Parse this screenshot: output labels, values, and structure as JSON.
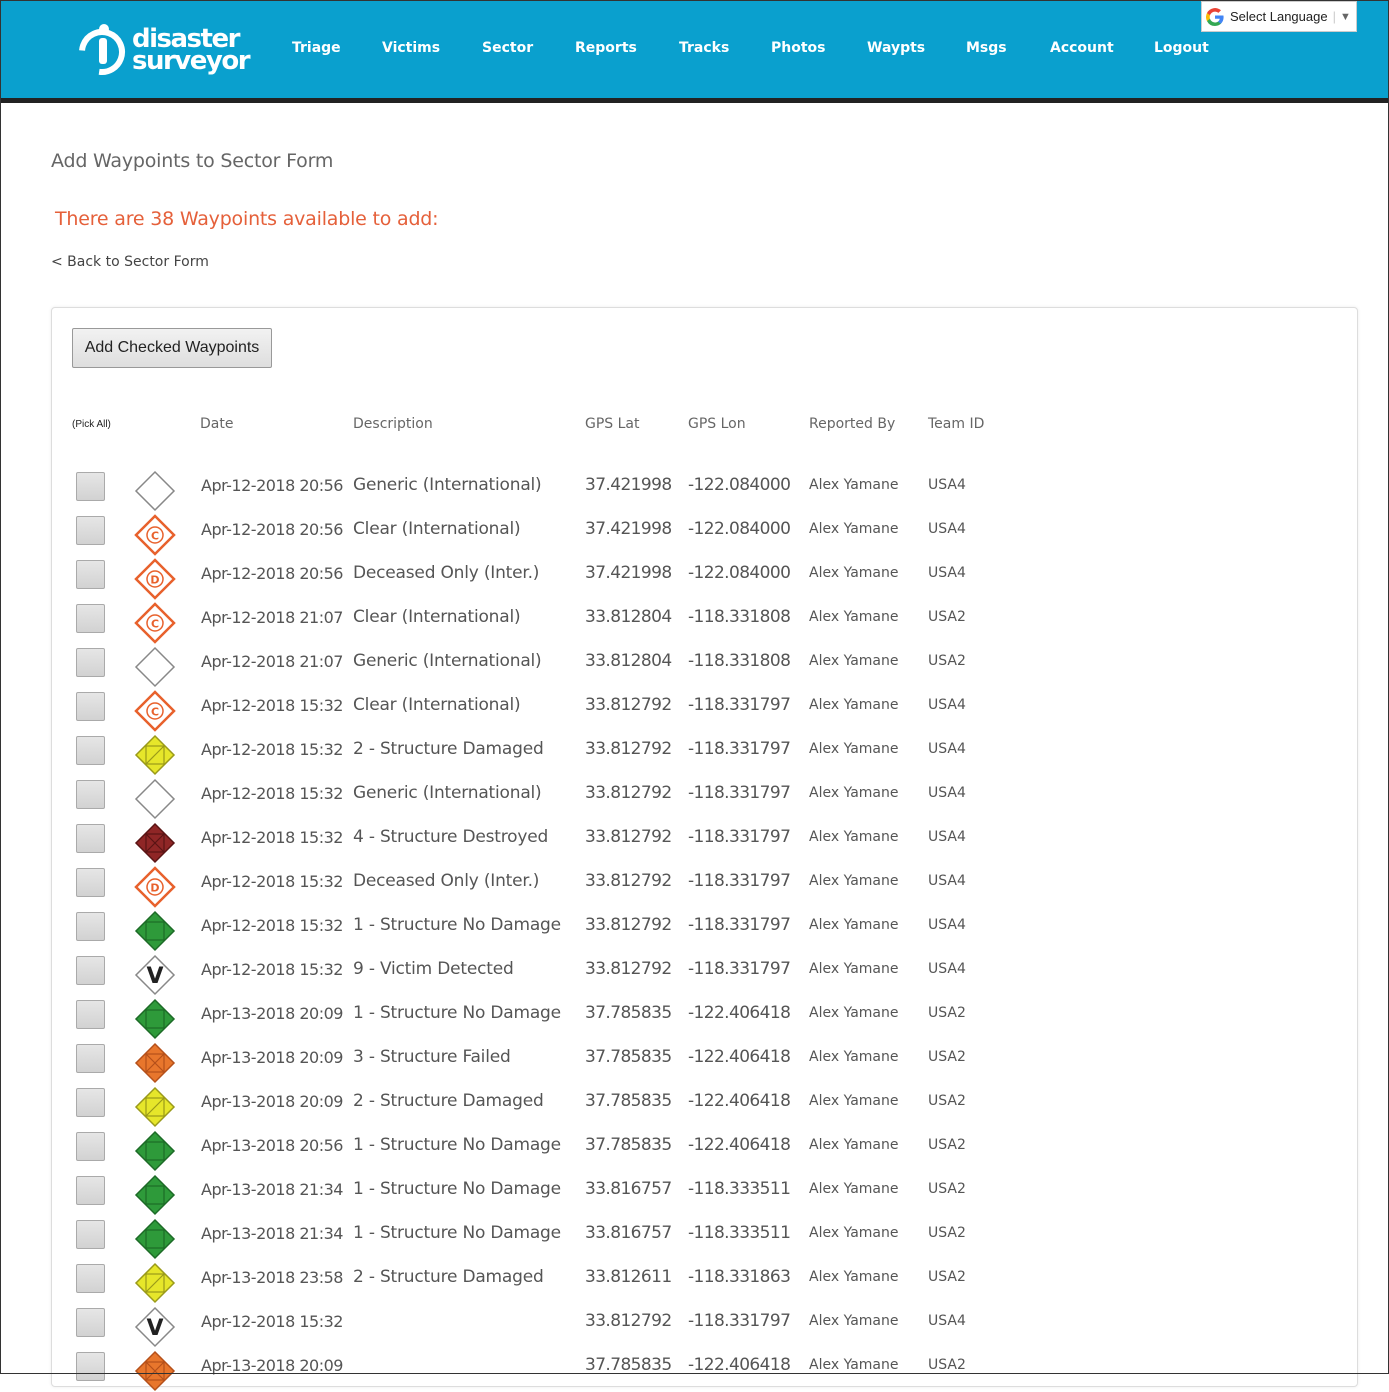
{
  "header": {
    "logo_line1": "disaster",
    "logo_line2": "surveyor",
    "nav": [
      "Triage",
      "Victims",
      "Sector",
      "Reports",
      "Tracks",
      "Photos",
      "Waypts",
      "Msgs",
      "Account",
      "Logout"
    ],
    "language_label": "Select Language"
  },
  "page": {
    "title": "Add Waypoints to Sector Form",
    "available": "There are 38 Waypoints available to add:",
    "back_link": "< Back to Sector Form",
    "add_button": "Add Checked Waypoints"
  },
  "table": {
    "pick_all": "(Pick All)",
    "headers": {
      "date": "Date",
      "description": "Description",
      "lat": "GPS Lat",
      "lon": "GPS Lon",
      "reported_by": "Reported By",
      "team": "Team ID"
    },
    "rows": [
      {
        "icon": "generic",
        "date": "Apr-12-2018 20:56",
        "desc": "Generic (International)",
        "lat": "37.421998",
        "lon": "-122.084000",
        "by": "Alex Yamane",
        "team": "USA4"
      },
      {
        "icon": "clear",
        "date": "Apr-12-2018 20:56",
        "desc": "Clear (International)",
        "lat": "37.421998",
        "lon": "-122.084000",
        "by": "Alex Yamane",
        "team": "USA4"
      },
      {
        "icon": "deceased",
        "date": "Apr-12-2018 20:56",
        "desc": "Deceased Only (Inter.)",
        "lat": "37.421998",
        "lon": "-122.084000",
        "by": "Alex Yamane",
        "team": "USA4"
      },
      {
        "icon": "clear",
        "date": "Apr-12-2018 21:07",
        "desc": "Clear (International)",
        "lat": "33.812804",
        "lon": "-118.331808",
        "by": "Alex Yamane",
        "team": "USA2"
      },
      {
        "icon": "generic",
        "date": "Apr-12-2018 21:07",
        "desc": "Generic (International)",
        "lat": "33.812804",
        "lon": "-118.331808",
        "by": "Alex Yamane",
        "team": "USA2"
      },
      {
        "icon": "clear",
        "date": "Apr-12-2018 15:32",
        "desc": "Clear (International)",
        "lat": "33.812792",
        "lon": "-118.331797",
        "by": "Alex Yamane",
        "team": "USA4"
      },
      {
        "icon": "damaged",
        "date": "Apr-12-2018 15:32",
        "desc": "2 - Structure Damaged",
        "lat": "33.812792",
        "lon": "-118.331797",
        "by": "Alex Yamane",
        "team": "USA4"
      },
      {
        "icon": "generic",
        "date": "Apr-12-2018 15:32",
        "desc": "Generic (International)",
        "lat": "33.812792",
        "lon": "-118.331797",
        "by": "Alex Yamane",
        "team": "USA4"
      },
      {
        "icon": "destroyed",
        "date": "Apr-12-2018 15:32",
        "desc": "4 - Structure Destroyed",
        "lat": "33.812792",
        "lon": "-118.331797",
        "by": "Alex Yamane",
        "team": "USA4"
      },
      {
        "icon": "deceased",
        "date": "Apr-12-2018 15:32",
        "desc": "Deceased Only (Inter.)",
        "lat": "33.812792",
        "lon": "-118.331797",
        "by": "Alex Yamane",
        "team": "USA4"
      },
      {
        "icon": "nodamage",
        "date": "Apr-12-2018 15:32",
        "desc": "1 - Structure No Damage",
        "lat": "33.812792",
        "lon": "-118.331797",
        "by": "Alex Yamane",
        "team": "USA4"
      },
      {
        "icon": "victim",
        "date": "Apr-12-2018 15:32",
        "desc": "9 - Victim Detected",
        "lat": "33.812792",
        "lon": "-118.331797",
        "by": "Alex Yamane",
        "team": "USA4"
      },
      {
        "icon": "nodamage",
        "date": "Apr-13-2018 20:09",
        "desc": "1 - Structure No Damage",
        "lat": "37.785835",
        "lon": "-122.406418",
        "by": "Alex Yamane",
        "team": "USA2"
      },
      {
        "icon": "failed",
        "date": "Apr-13-2018 20:09",
        "desc": "3 - Structure Failed",
        "lat": "37.785835",
        "lon": "-122.406418",
        "by": "Alex Yamane",
        "team": "USA2"
      },
      {
        "icon": "damaged",
        "date": "Apr-13-2018 20:09",
        "desc": "2 - Structure Damaged",
        "lat": "37.785835",
        "lon": "-122.406418",
        "by": "Alex Yamane",
        "team": "USA2"
      },
      {
        "icon": "nodamage",
        "date": "Apr-13-2018 20:56",
        "desc": "1 - Structure No Damage",
        "lat": "37.785835",
        "lon": "-122.406418",
        "by": "Alex Yamane",
        "team": "USA2"
      },
      {
        "icon": "nodamage",
        "date": "Apr-13-2018 21:34",
        "desc": "1 - Structure No Damage",
        "lat": "33.816757",
        "lon": "-118.333511",
        "by": "Alex Yamane",
        "team": "USA2"
      },
      {
        "icon": "nodamage",
        "date": "Apr-13-2018 21:34",
        "desc": "1 - Structure No Damage",
        "lat": "33.816757",
        "lon": "-118.333511",
        "by": "Alex Yamane",
        "team": "USA2"
      },
      {
        "icon": "damaged",
        "date": "Apr-13-2018 23:58",
        "desc": "2 - Structure Damaged",
        "lat": "33.812611",
        "lon": "-118.331863",
        "by": "Alex Yamane",
        "team": "USA2"
      },
      {
        "icon": "victim",
        "date": "Apr-12-2018 15:32",
        "desc": "",
        "lat": "33.812792",
        "lon": "-118.331797",
        "by": "Alex Yamane",
        "team": "USA4"
      },
      {
        "icon": "failed",
        "date": "Apr-13-2018 20:09",
        "desc": "",
        "lat": "37.785835",
        "lon": "-122.406418",
        "by": "Alex Yamane",
        "team": "USA2"
      }
    ]
  },
  "icon_styles": {
    "generic": {
      "fill": "#ffffff",
      "stroke": "#888888",
      "letter": ""
    },
    "clear": {
      "fill": "#ffffff",
      "stroke": "#e8612c",
      "letter": "C"
    },
    "deceased": {
      "fill": "#ffffff",
      "stroke": "#e8612c",
      "letter": "D"
    },
    "victim": {
      "fill": "#ffffff",
      "stroke": "#888888",
      "letter": "V"
    },
    "nodamage": {
      "fill": "#2e9a3a",
      "stroke": "#1d6b27",
      "letter": ""
    },
    "damaged": {
      "fill": "#e6e62a",
      "stroke": "#9a9a1a",
      "letter": ""
    },
    "failed": {
      "fill": "#e8762c",
      "stroke": "#b5501a",
      "letter": ""
    },
    "destroyed": {
      "fill": "#8f2626",
      "stroke": "#5a1414",
      "letter": ""
    }
  },
  "colors": {
    "header_bg": "#0aa0ce",
    "alert_text": "#e5603a"
  }
}
